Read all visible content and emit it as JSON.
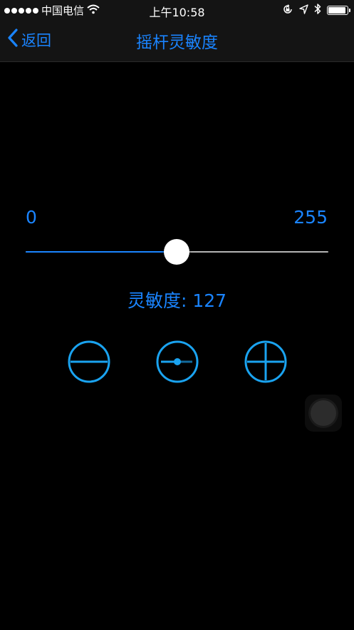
{
  "status_bar": {
    "carrier": "中国电信",
    "time": "上午10:58",
    "icons": [
      "signal-dots-icon",
      "wifi-icon",
      "rotation-lock-icon",
      "location-icon",
      "bluetooth-icon",
      "battery-icon"
    ]
  },
  "nav": {
    "back_label": "返回",
    "title": "摇杆灵敏度"
  },
  "slider": {
    "min_label": "0",
    "max_label": "255",
    "min": 0,
    "max": 255,
    "value": 127
  },
  "readout": {
    "text": "灵敏度: 127"
  },
  "controls": [
    {
      "name": "decrease-button",
      "icon": "minus-circle-icon"
    },
    {
      "name": "reset-button",
      "icon": "center-circle-icon"
    },
    {
      "name": "increase-button",
      "icon": "plus-circle-icon"
    }
  ],
  "colors": {
    "accent": "#1a84ff",
    "icon_accent": "#1aa3f0",
    "background": "#000000",
    "bar": "#141414",
    "track": "#b4b4b4"
  }
}
